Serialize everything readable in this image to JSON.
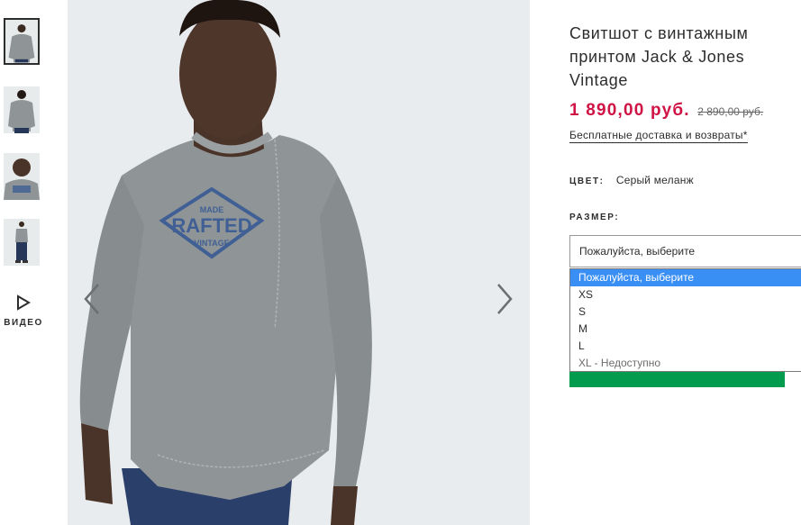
{
  "thumbnails": [
    {
      "name": "thumbnail-front",
      "active": true
    },
    {
      "name": "thumbnail-back",
      "active": false
    },
    {
      "name": "thumbnail-closeup",
      "active": false
    },
    {
      "name": "thumbnail-full-body",
      "active": false
    }
  ],
  "video": {
    "label": "ВИДЕО",
    "icon": "play-icon"
  },
  "gallery": {
    "prev_icon": "chevron-left-icon",
    "next_icon": "chevron-right-icon",
    "print_line1": "MADE",
    "print_line2": "RAFTED",
    "print_line3": "VINTAGE"
  },
  "product": {
    "title": "Свитшот с винтажным принтом Jack & Jones Vintage",
    "price_current": "1 890,00 руб.",
    "price_old": "2 890,00 руб.",
    "delivery_link": "Бесплатные доставка и возвраты*",
    "color_label": "ЦВЕТ:",
    "color_value": "Серый меланж",
    "size_label": "РАЗМЕР:",
    "size_placeholder": "Пожалуйста, выберите",
    "size_options": [
      "Пожалуйста, выберите",
      "XS",
      "S",
      "M",
      "L",
      "XL - Недоступно"
    ]
  },
  "colors": {
    "price_red": "#d01345",
    "selected_option": "#3a8ff5",
    "add_button_green": "#039b4e",
    "sweater_grey": "#8f9496",
    "print_blue": "#3f5f95"
  }
}
